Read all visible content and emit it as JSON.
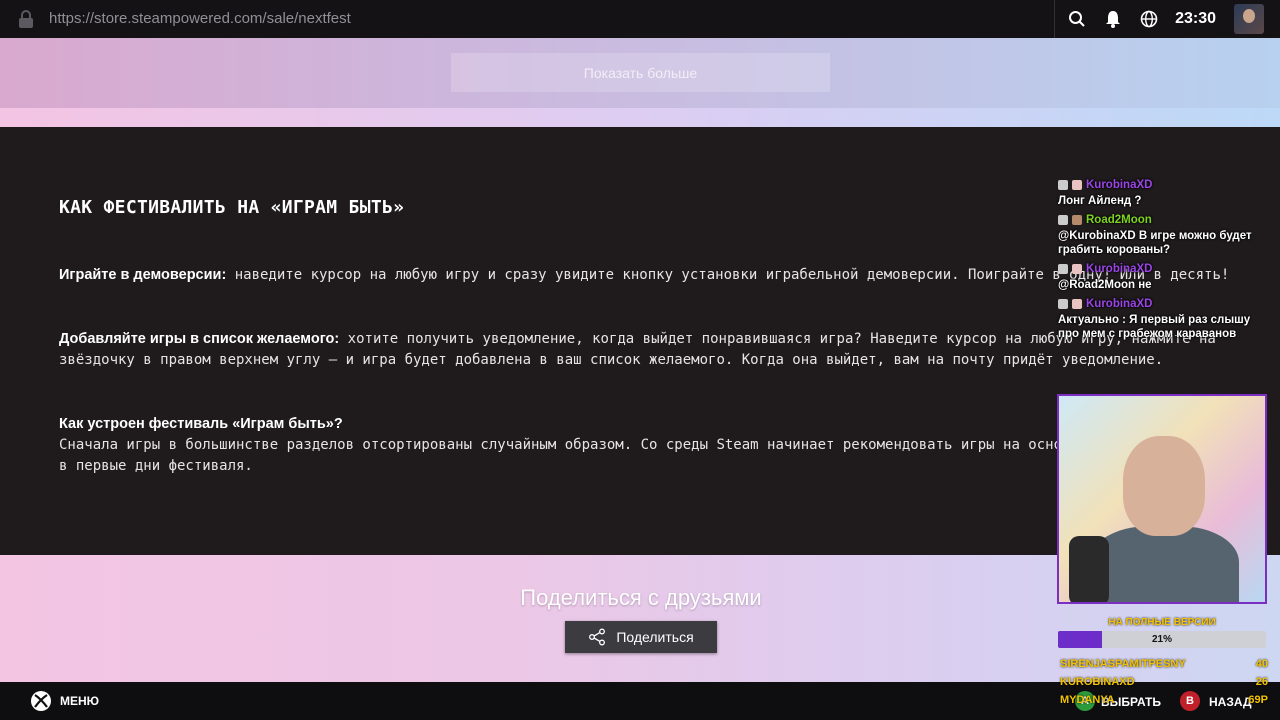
{
  "browser": {
    "url": "https://store.steampowered.com/sale/nextfest",
    "time": "23:30",
    "icons": [
      "lock-icon",
      "search-icon",
      "bell-icon",
      "globe-icon"
    ]
  },
  "top_section": {
    "show_more_label": "Показать больше"
  },
  "content": {
    "heading": "КАК ФЕСТИВАЛИТЬ НА «ИГРАМ БЫТЬ»",
    "paragraphs": [
      {
        "title": "Играйте в демоверсии:",
        "body": " наведите курсор на любую игру и сразу увидите кнопку установки играбельной демоверсии. Поиграйте в одну! Или в десять!"
      },
      {
        "title": "Добавляйте игры в список желаемого:",
        "body": " хотите получить уведомление, когда выйдет понравившаяся игра? Наведите курсор на любую игру, нажмите на звёздочку в правом верхнем углу — и игра будет добавлена в ваш список желаемого. Когда она выйдет, вам на почту придёт уведомление."
      },
      {
        "title": "Как устроен фестиваль «Играм быть»?",
        "body": "Сначала игры в большинстве разделов отсортированы случайным образом. Со среды Steam начинает рекомендовать игры на основе данных, собранных в первые дни фестиваля."
      }
    ]
  },
  "share": {
    "title": "Поделиться с друзьями",
    "button_label": "Поделиться"
  },
  "footer": {
    "menu_label": "МЕНЮ",
    "a_key": "A",
    "a_label": "ВЫБРАТЬ",
    "b_key": "B",
    "b_label": "НАЗАД"
  },
  "stream": {
    "chat": [
      {
        "user": "KurobinaXD",
        "color": "#9b45e6",
        "text": "Лонг Айленд ?"
      },
      {
        "user": "Road2Moon",
        "color": "#7ed321",
        "text": "@KurobinaXD В игре можно будет грабить корованы?"
      },
      {
        "user": "KurobinaXD",
        "color": "#9b45e6",
        "text": "@Road2Moon не"
      },
      {
        "user": "KurobinaXD",
        "color": "#9b45e6",
        "text": "Актуально : Я первый раз слышу про мем с грабежом караванов"
      }
    ],
    "goal_label": "НА ПОЛНЫЕ ВЕРСИИ",
    "goal_percent": "21%",
    "goal_fraction": 0.21,
    "top": [
      {
        "name": "SIRENJASPAMITPESNY",
        "value": "40"
      },
      {
        "name": "KUROBINAXD",
        "value": "26"
      },
      {
        "name": "MYDANYA",
        "value": "69P"
      }
    ]
  }
}
